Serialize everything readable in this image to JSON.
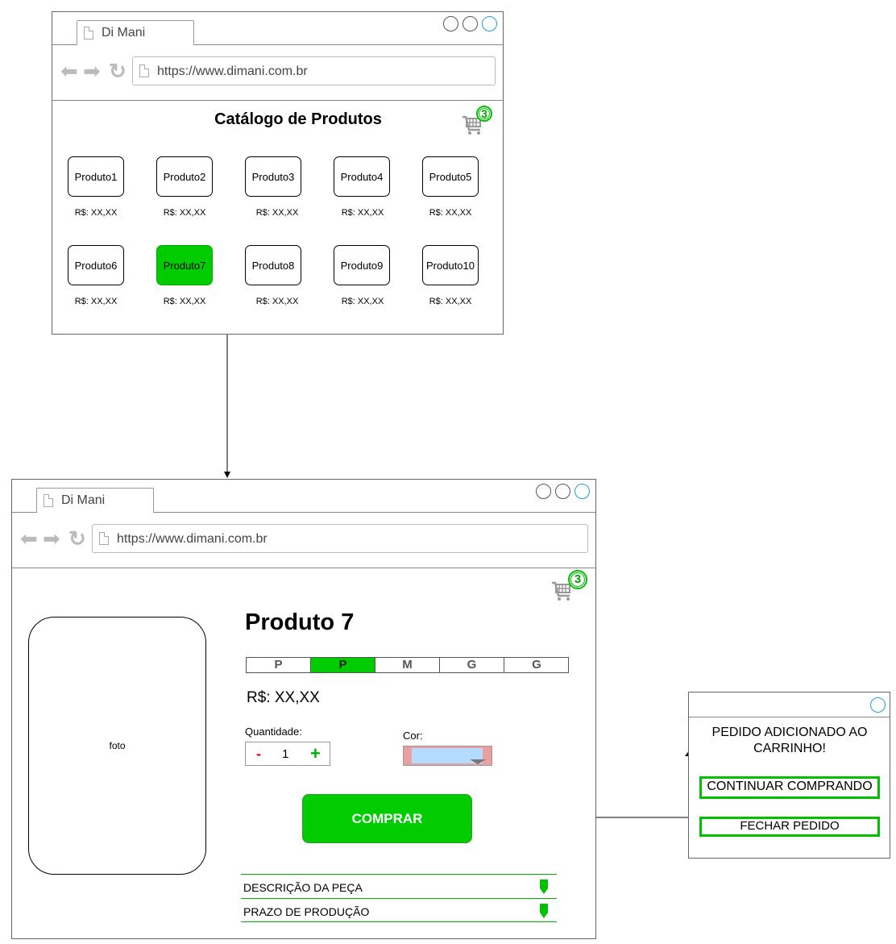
{
  "catalog_window": {
    "tab_title": "Di Mani",
    "url": "https://www.dimani.com.br",
    "heading": "Catálogo de Produtos",
    "cart_count": "3",
    "products": [
      {
        "name": "Produto1",
        "price": "R$: XX,XX"
      },
      {
        "name": "Produto2",
        "price": "R$: XX,XX"
      },
      {
        "name": "Produto3",
        "price": "R$: XX,XX"
      },
      {
        "name": "Produto4",
        "price": "R$: XX,XX"
      },
      {
        "name": "Produto5",
        "price": "R$: XX,XX"
      },
      {
        "name": "Produto6",
        "price": "R$: XX,XX"
      },
      {
        "name": "Produto7",
        "price": "R$: XX,XX"
      },
      {
        "name": "Produto8",
        "price": "R$: XX,XX"
      },
      {
        "name": "Produto9",
        "price": "R$: XX,XX"
      },
      {
        "name": "Produto10",
        "price": "R$: XX,XX"
      }
    ],
    "selected_product": "Produto7"
  },
  "product_window": {
    "tab_title": "Di Mani",
    "url": "https://www.dimani.com.br",
    "cart_count": "3",
    "photo_label": "foto",
    "title": "Produto 7",
    "sizes": [
      "P",
      "P",
      "M",
      "G",
      "G"
    ],
    "selected_size_index": 1,
    "price": "R$: XX,XX",
    "quantity_label": "Quantidade:",
    "quantity_minus": "-",
    "quantity_value": "1",
    "quantity_plus": "+",
    "color_label": "Cor:",
    "buy_button": "COMPRAR",
    "accordion": [
      "DESCRIÇÃO DA PEÇA",
      "PRAZO DE PRODUÇÃO"
    ]
  },
  "dialog": {
    "message": "PEDIDO ADICIONADO AO CARRINHO!",
    "continue_button": "CONTINUAR COMPRANDO",
    "close_order_button": "FECHAR PEDIDO"
  },
  "colors": {
    "accent_green": "#00cc00",
    "window_border": "#666666",
    "close_circle_blue": "#1f9ee0"
  }
}
